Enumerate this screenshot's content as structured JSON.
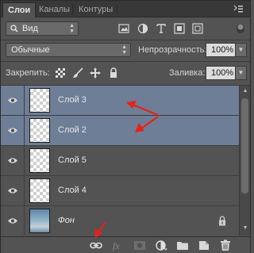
{
  "tabs": [
    {
      "label": "Слои",
      "active": true
    },
    {
      "label": "Каналы",
      "active": false
    },
    {
      "label": "Контуры",
      "active": false
    }
  ],
  "filter": {
    "kind_label": "Вид",
    "icons": [
      "image-filter-icon",
      "adjustment-filter-icon",
      "type-filter-icon",
      "shape-filter-icon",
      "smart-object-filter-icon"
    ]
  },
  "blend": {
    "mode": "Обычные",
    "opacity_label": "Непрозрачность:",
    "opacity_value": "100%"
  },
  "lock": {
    "label": "Закрепить:",
    "fill_label": "Заливка:",
    "fill_value": "100%"
  },
  "layers": [
    {
      "name": "Слой 3",
      "selected": true,
      "thumb": "transparent"
    },
    {
      "name": "Слой 2",
      "selected": true,
      "thumb": "transparent"
    },
    {
      "name": "Слой 5",
      "selected": false,
      "thumb": "transparent"
    },
    {
      "name": "Слой 4",
      "selected": false,
      "thumb": "transparent"
    },
    {
      "name": "Фон",
      "selected": false,
      "thumb": "photo",
      "locked": true
    }
  ],
  "bottom_icons": [
    "link-layers-icon",
    "fx-icon",
    "layer-mask-icon",
    "adjustment-layer-icon",
    "new-group-icon",
    "new-layer-icon",
    "trash-icon"
  ],
  "colors": {
    "panel_bg": "#535353",
    "selected_row": "#6d7e96",
    "annotation_red": "#e8201a"
  }
}
